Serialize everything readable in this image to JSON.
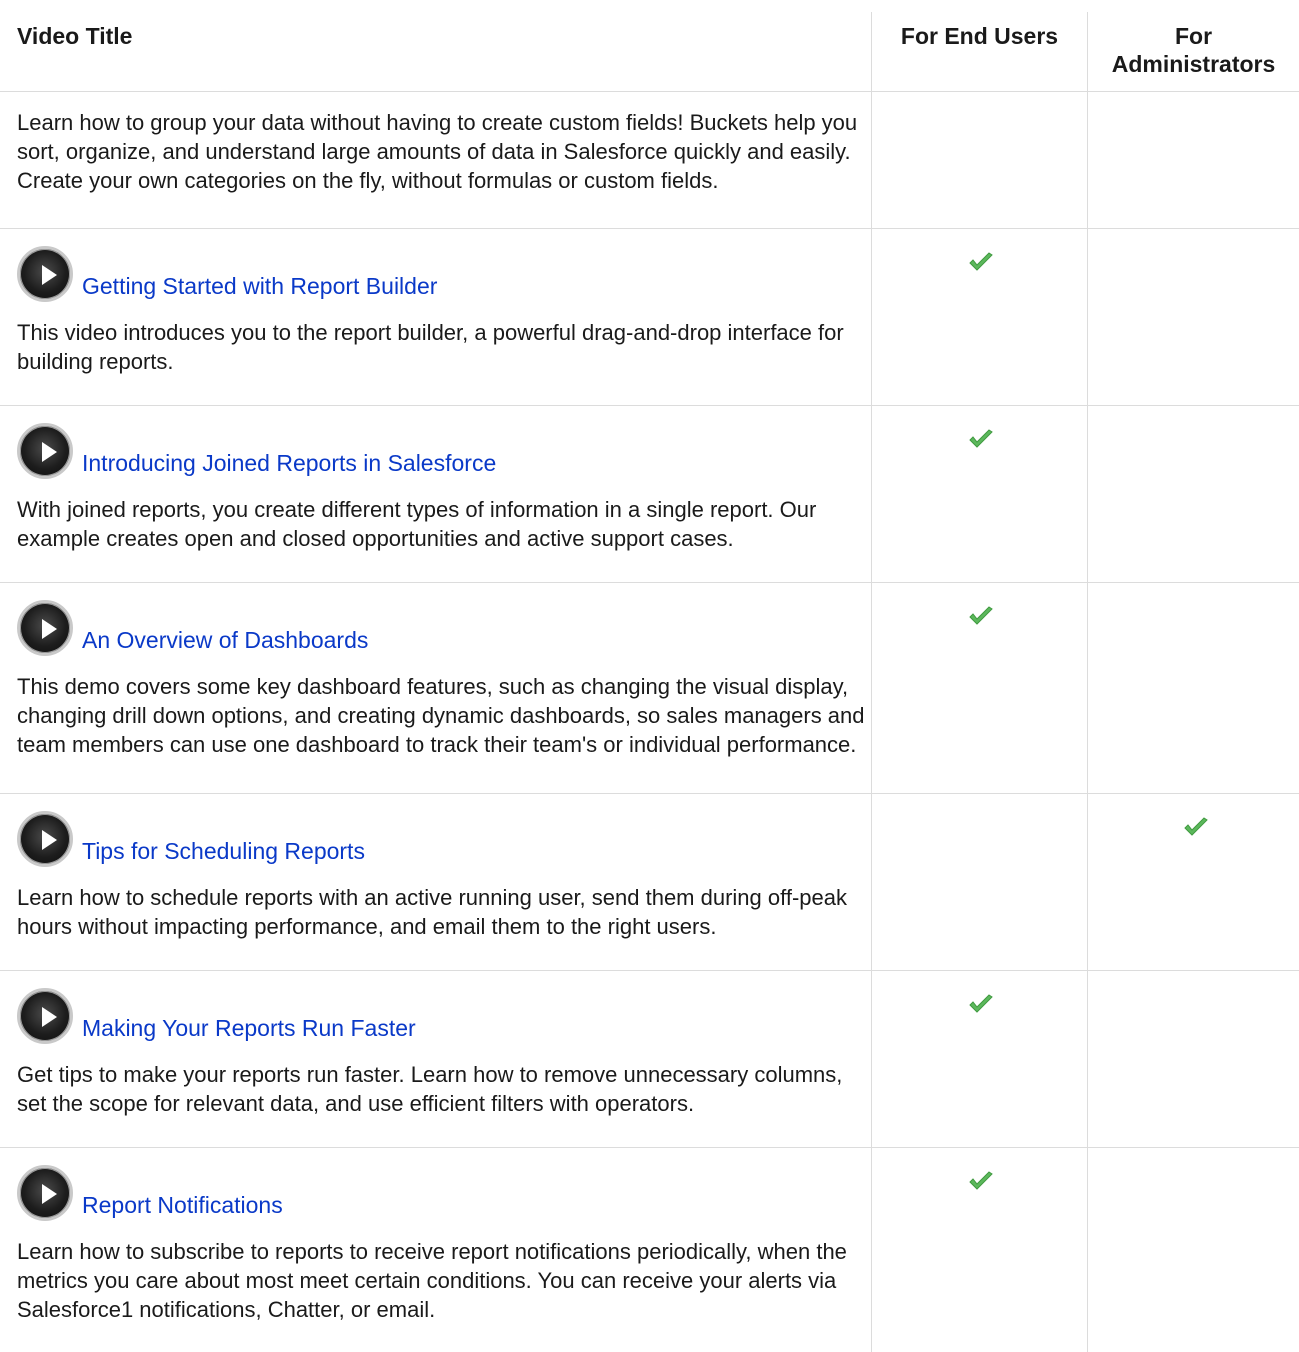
{
  "header": {
    "col_title": "Video Title",
    "col_end_users": "For End Users",
    "col_admins_line1": "For",
    "col_admins_line2": "Administrators"
  },
  "intro_row": {
    "description": "Learn how to group your data without having to create custom fields! Buckets help you sort, organize, and understand large amounts of data in Salesforce quickly and easily. Create your own categories on the fly, without formulas or custom fields."
  },
  "rows": [
    {
      "title": "Getting Started with Report Builder",
      "description": "This video introduces you to the report builder, a powerful drag-and-drop interface for building reports.",
      "for_end_users": true,
      "for_administrators": false
    },
    {
      "title": "Introducing Joined Reports in Salesforce",
      "description": "With joined reports, you create different types of information in a single report. Our example creates open and closed opportunities and active support cases.",
      "for_end_users": true,
      "for_administrators": false
    },
    {
      "title": "An Overview of Dashboards",
      "description": "This demo covers some key dashboard features, such as changing the visual display, changing drill down options, and creating dynamic dashboards, so sales managers and team members can use one dashboard to track their team's or individual performance.",
      "for_end_users": true,
      "for_administrators": false
    },
    {
      "title": "Tips for Scheduling Reports",
      "description": "Learn how to schedule reports with an active running user, send them during off-peak hours without impacting performance, and email them to the right users.",
      "for_end_users": false,
      "for_administrators": true
    },
    {
      "title": "Making Your Reports Run Faster",
      "description": "Get tips to make your reports run faster. Learn how to remove unnecessary columns, set the scope for relevant data, and use efficient filters with operators.",
      "for_end_users": true,
      "for_administrators": false
    },
    {
      "title": "Report Notifications",
      "description": "Learn how to subscribe to reports to receive report notifications periodically, when the metrics you care about most meet certain conditions. You can receive your alerts via Salesforce1 notifications, Chatter, or email.",
      "for_end_users": true,
      "for_administrators": false
    }
  ],
  "icons": {
    "play": "play-video-icon",
    "check": "checkmark-icon"
  },
  "colors": {
    "link": "#0a39c8",
    "check": "#5cb85c",
    "grid": "#dcdcdc"
  }
}
